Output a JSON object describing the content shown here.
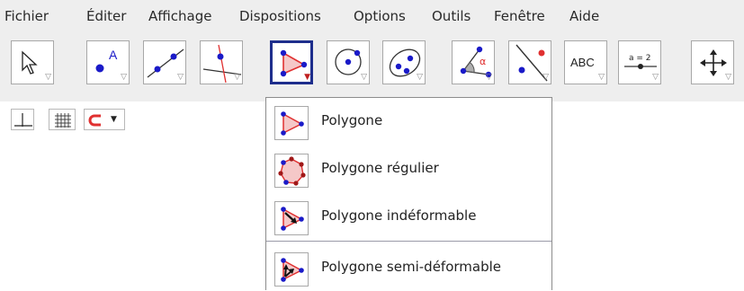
{
  "menubar": {
    "items": [
      {
        "label": "Fichier"
      },
      {
        "label": "Éditer"
      },
      {
        "label": "Affichage"
      },
      {
        "label": "Dispositions"
      },
      {
        "label": "Options"
      },
      {
        "label": "Outils"
      },
      {
        "label": "Fenêtre"
      },
      {
        "label": "Aide"
      }
    ]
  },
  "toolbar": {
    "text_tool_label": "ABC",
    "slider_tool_label": "a = 2",
    "angle_symbol": "α",
    "dropdown_triangle": "▽",
    "selected_triangle": "▼",
    "selected_tool": "polygon-tool",
    "tools": [
      {
        "icon": "arrow-cursor-icon"
      },
      {
        "icon": "point-icon"
      },
      {
        "icon": "line-icon"
      },
      {
        "icon": "perpendicular-line-icon"
      },
      {
        "icon": "polygon-icon"
      },
      {
        "icon": "circle-center-point-icon"
      },
      {
        "icon": "ellipse-icon"
      },
      {
        "icon": "angle-icon"
      },
      {
        "icon": "reflect-about-line-icon"
      },
      {
        "icon": "text-icon"
      },
      {
        "icon": "slider-icon"
      },
      {
        "icon": "move-graphics-view-icon"
      }
    ]
  },
  "stylebar": {
    "dropdown_arrow": "▼",
    "buttons": [
      {
        "icon": "axes-icon"
      },
      {
        "icon": "grid-icon"
      },
      {
        "icon": "point-capturing-icon"
      }
    ]
  },
  "polygon_menu": {
    "items": [
      {
        "label": "Polygone",
        "icon": "polygon-icon"
      },
      {
        "label": "Polygone régulier",
        "icon": "regular-polygon-icon"
      },
      {
        "label": "Polygone indéformable",
        "icon": "rigid-polygon-icon"
      },
      {
        "label": "Polygone semi-déformable",
        "icon": "vector-polygon-icon"
      }
    ]
  },
  "colors": {
    "accent": "#1e2e8c",
    "point_blue": "#1a1ac8",
    "polygon_red": "#e03030",
    "polygon_fill": "#f5c8c8"
  }
}
